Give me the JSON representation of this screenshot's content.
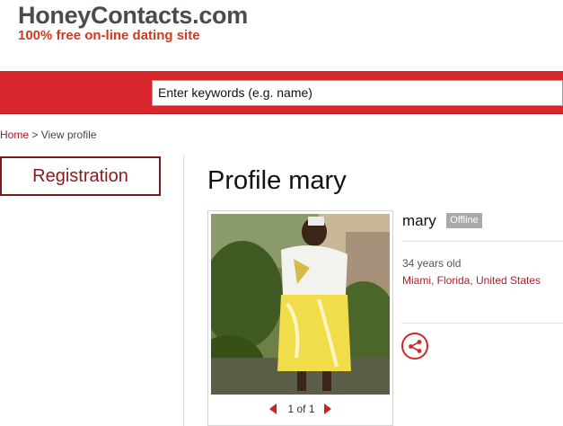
{
  "header": {
    "site_name": "HoneyContacts.com",
    "tagline": "100% free on-line dating site"
  },
  "search": {
    "placeholder": "Enter keywords (e.g. name)"
  },
  "breadcrumb": {
    "home": "Home",
    "separator": ">",
    "current": "View profile"
  },
  "sidebar": {
    "registration_label": "Registration"
  },
  "profile": {
    "title": "Profile mary",
    "name": "mary",
    "status": "Offline",
    "age": "34 years old",
    "location": "Miami, Florida, United States",
    "photo_pager": "1 of 1"
  },
  "colors": {
    "accent_red": "#d8262d",
    "link_red": "#b0202a",
    "logo_gray": "#4f4a4a",
    "tagline_orange": "#cf3a1e"
  },
  "icons": {
    "share": "share-icon",
    "prev": "chevron-left-icon",
    "next": "chevron-right-icon"
  }
}
